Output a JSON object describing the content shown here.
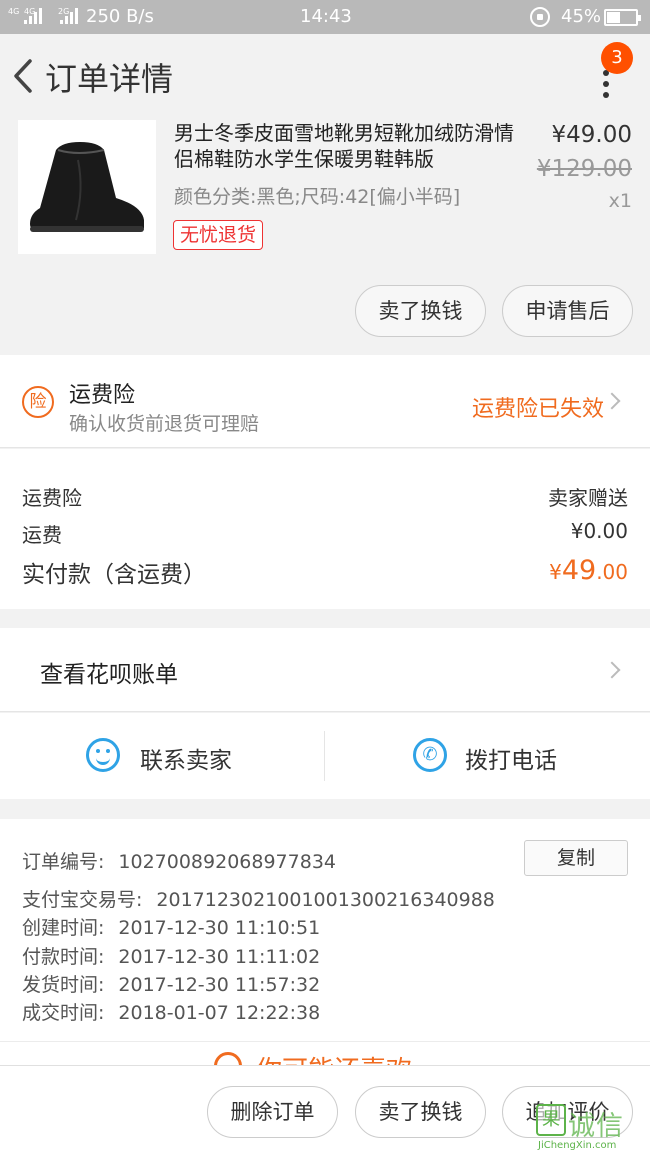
{
  "status_bar": {
    "network_1": "4G",
    "network_2": "4G",
    "network_3": "2G",
    "speed": "250 B/s",
    "time": "14:43",
    "battery": "45%"
  },
  "header": {
    "title": "订单详情",
    "badge_count": "3"
  },
  "product": {
    "name": "男士冬季皮面雪地靴男短靴加绒防滑情侣棉鞋防水学生保暖男鞋韩版",
    "spec": "颜色分类:黑色;尺码:42[偏小半码]",
    "tag": "无忧退货",
    "price": "¥49.00",
    "original_price": "¥129.00",
    "quantity": "x1",
    "sell_button": "卖了换钱",
    "aftersale_button": "申请售后"
  },
  "insurance": {
    "icon_char": "险",
    "title": "运费险",
    "subtitle": "确认收货前退货可理赔",
    "status": "运费险已失效"
  },
  "fees": {
    "insurance_label": "运费险",
    "insurance_value": "卖家赠送",
    "shipping_label": "运费",
    "shipping_value": "¥0.00",
    "paid_label": "实付款（含运费）",
    "paid_currency": "¥",
    "paid_int": "49",
    "paid_dec": ".00"
  },
  "huabei": {
    "label": "查看花呗账单"
  },
  "contact": {
    "seller_label": "联系卖家",
    "phone_label": "拨打电话"
  },
  "order_info": {
    "order_no_label": "订单编号:",
    "order_no": "102700892068977834",
    "copy_label": "复制",
    "alipay_label": "支付宝交易号:",
    "alipay_no": "2017123021001001300216340988",
    "created_label": "创建时间:",
    "created": "2017-12-30 11:10:51",
    "paid_label": "付款时间:",
    "paid": "2017-12-30 11:11:02",
    "shipped_label": "发货时间:",
    "shipped": "2017-12-30 11:57:32",
    "completed_label": "成交时间:",
    "completed": "2018-01-07 12:22:38"
  },
  "peek": {
    "text": "你可能还喜欢"
  },
  "bottom_bar": {
    "delete_button": "删除订单",
    "sell_button": "卖了换钱",
    "review_button": "追加评价"
  },
  "watermark": {
    "logo_char": "果",
    "text": "诚信",
    "url": "JiChengXin.com"
  },
  "colors": {
    "accent_orange": "#f06b1f",
    "badge": "#ff5000",
    "tag_red": "#e33333",
    "link_blue": "#2fa3e6",
    "watermark_green": "#5db34a"
  }
}
